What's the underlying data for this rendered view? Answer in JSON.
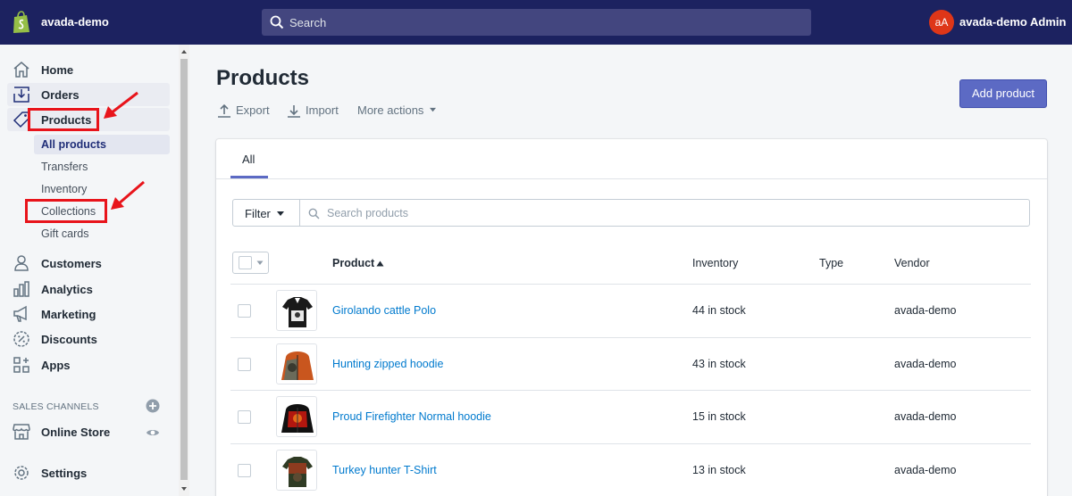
{
  "topbar": {
    "store_name": "avada-demo",
    "search_placeholder": "Search",
    "avatar_initials": "aA",
    "admin_name": "avada-demo Admin",
    "bg_color": "#1c2260",
    "icons": {
      "logo": "shopify-bag-icon",
      "search": "search-icon"
    }
  },
  "sidebar": {
    "items": [
      {
        "label": "Home",
        "icon": "home-icon"
      },
      {
        "label": "Orders",
        "icon": "orders-icon"
      },
      {
        "label": "Products",
        "icon": "tag-icon"
      }
    ],
    "products_sub": [
      {
        "label": "All products"
      },
      {
        "label": "Transfers"
      },
      {
        "label": "Inventory"
      },
      {
        "label": "Collections"
      },
      {
        "label": "Gift cards"
      }
    ],
    "items_after": [
      {
        "label": "Customers",
        "icon": "person-icon"
      },
      {
        "label": "Analytics",
        "icon": "bar-chart-icon"
      },
      {
        "label": "Marketing",
        "icon": "megaphone-icon"
      },
      {
        "label": "Discounts",
        "icon": "discount-icon"
      },
      {
        "label": "Apps",
        "icon": "apps-icon"
      }
    ],
    "sales_channels_title": "SALES CHANNELS",
    "online_store": "Online Store",
    "settings": "Settings"
  },
  "main": {
    "title": "Products",
    "actions": {
      "export": "Export",
      "import": "Import",
      "more": "More actions"
    },
    "add_button": "Add product",
    "tab_all": "All",
    "filter_label": "Filter",
    "search_placeholder": "Search products",
    "columns": {
      "product": "Product",
      "inventory": "Inventory",
      "type": "Type",
      "vendor": "Vendor"
    },
    "rows": [
      {
        "name": "Girolando cattle Polo",
        "inventory": "44 in stock",
        "type": "",
        "vendor": "avada-demo"
      },
      {
        "name": "Hunting zipped hoodie",
        "inventory": "43 in stock",
        "type": "",
        "vendor": "avada-demo"
      },
      {
        "name": "Proud Firefighter Normal hoodie",
        "inventory": "15 in stock",
        "type": "",
        "vendor": "avada-demo"
      },
      {
        "name": "Turkey hunter T-Shirt",
        "inventory": "13 in stock",
        "type": "",
        "vendor": "avada-demo"
      }
    ]
  },
  "colors": {
    "accent": "#5c6ac4",
    "link": "#007ace",
    "annotation": "#e8141b",
    "avatar": "#de3618"
  }
}
